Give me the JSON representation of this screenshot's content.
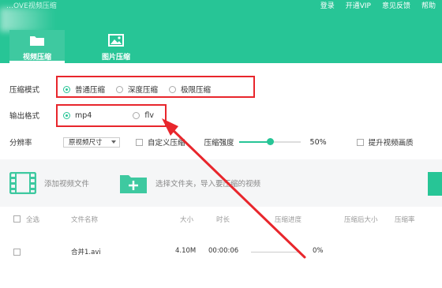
{
  "header": {
    "app_title": "…OVE视频压缩",
    "links": [
      "登录",
      "开通VIP",
      "意见反馈",
      "帮助"
    ],
    "tabs": [
      {
        "label": "视频压缩",
        "icon": "video-folder-icon",
        "active": true
      },
      {
        "label": "图片压缩",
        "icon": "image-icon",
        "active": false
      }
    ]
  },
  "settings": {
    "mode_label": "压缩模式",
    "modes": [
      {
        "label": "普通压缩",
        "checked": true
      },
      {
        "label": "深度压缩",
        "checked": false
      },
      {
        "label": "极限压缩",
        "checked": false
      }
    ],
    "format_label": "输出格式",
    "formats": [
      {
        "label": "mp4",
        "checked": true
      },
      {
        "label": "flv",
        "checked": false
      }
    ],
    "resolution_label": "分辨率",
    "resolution_value": "原视频尺寸",
    "auto_label": "自定义压缩",
    "strength_label": "压缩强度",
    "strength_percent": 50,
    "strength_text": "50%",
    "quality_label": "提升视频画质"
  },
  "add": {
    "add_video": "添加视频文件",
    "add_folder": "选择文件夹，导入要压缩的视频"
  },
  "table": {
    "headers": [
      "全选",
      "文件名称",
      "大小",
      "时长",
      "压缩进度",
      "压缩后大小",
      "压缩率"
    ],
    "rows": [
      {
        "name": "合并1.avi",
        "size": "4.10M",
        "duration": "00:00:06",
        "progress": "0%"
      }
    ]
  },
  "colors": {
    "accent": "#27c596",
    "annotation": "#e8262c"
  }
}
